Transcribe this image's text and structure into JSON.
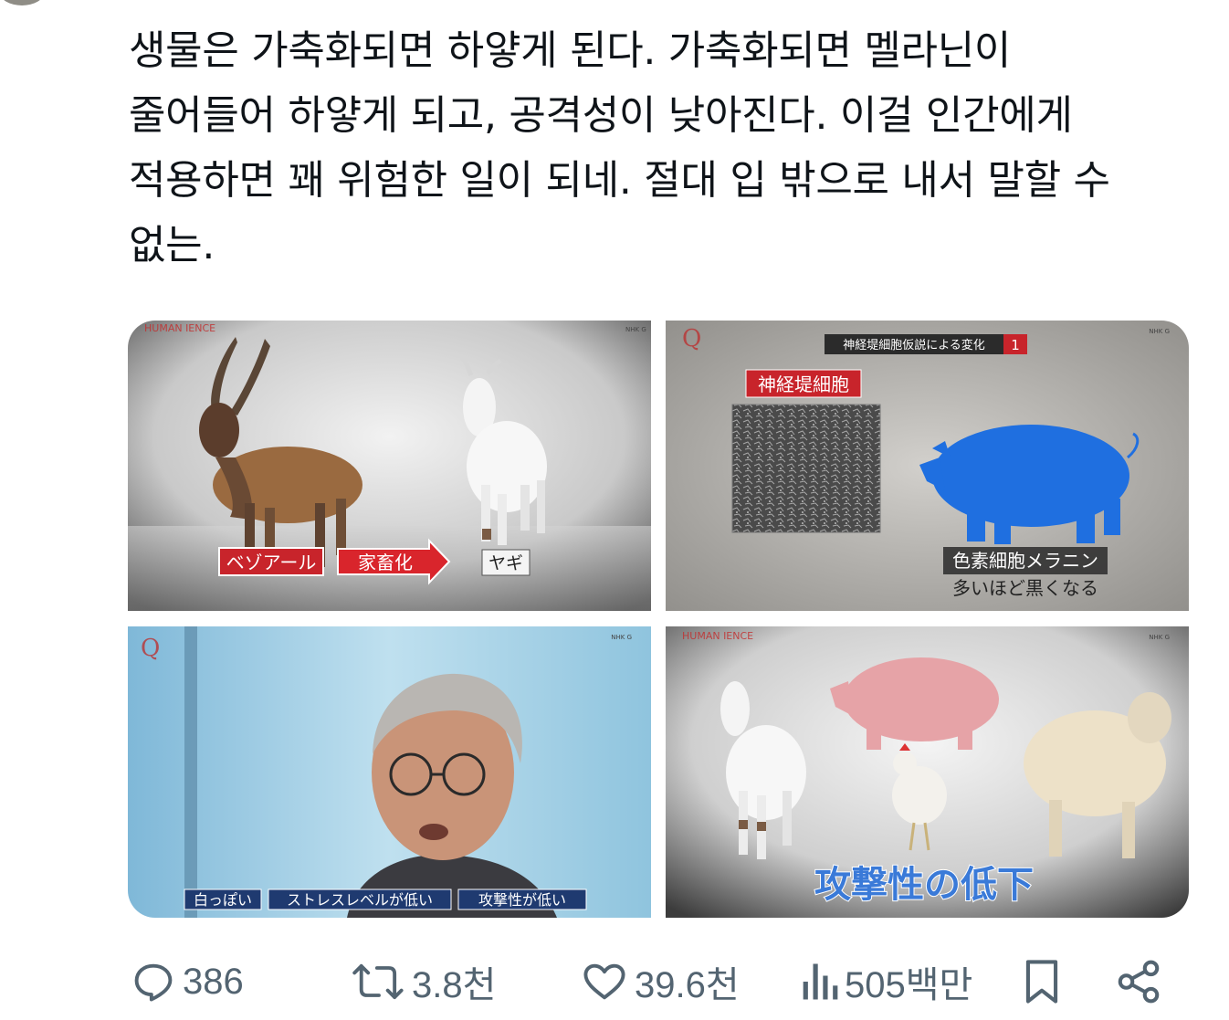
{
  "tweet": {
    "lines": [
      "생물은 가축화되면 하얗게 된다. 가축화되면 멜라닌이",
      "줄어들어 하얗게 되고, 공격성이 낮아진다. 이걸 인간에게",
      "적용하면 꽤 위험한 일이 되네. 절대 입 밖으로 내서 말할 수",
      "없는."
    ]
  },
  "media": {
    "tile1": {
      "logo": "HUMAN IENCE",
      "channel": "NHK G",
      "labels": [
        "ベゾアール",
        "家畜化",
        "ヤギ"
      ]
    },
    "tile2": {
      "channel": "NHK G",
      "header": "神経堤細胞仮説による変化",
      "header_num": "1",
      "cell_label": "神経堤細胞",
      "pigment_label": "色素細胞メラニン",
      "pigment_sub": "多いほど黒くなる"
    },
    "tile3": {
      "channel": "NHK G",
      "subtitles": [
        "白っぽい",
        "ストレスレベルが低い",
        "攻撃性が低い"
      ]
    },
    "tile4": {
      "channel": "NHK G",
      "logo": "HUMAN IENCE",
      "caption": "攻撃性の低下"
    }
  },
  "actions": {
    "replies": "386",
    "reposts": "3.8천",
    "likes": "39.6천",
    "views": "505백만"
  },
  "colors": {
    "text": "#0f1419",
    "muted": "#536471",
    "red_label": "#c8242b",
    "pig_blue": "#1f6fe0",
    "caption_blue": "#3a7ad8"
  },
  "icons": [
    "reply-icon",
    "repost-icon",
    "like-icon",
    "views-icon",
    "bookmark-icon",
    "share-icon"
  ]
}
